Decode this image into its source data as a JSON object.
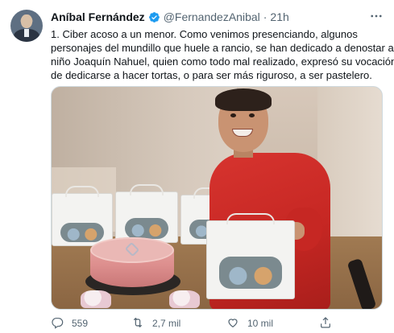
{
  "author": {
    "display_name": "Aníbal Fernández",
    "handle": "@FernandezAnibal",
    "separator": "·",
    "time": "21h"
  },
  "tweet": {
    "lines": [
      "1. Ciber acoso a un menor. Como venimos presenciando, algunos",
      "personajes del mundillo que huele a rancio, se han dedicado a denostar al",
      "niño Joaquín Nahuel, quien como todo mal realizado, expresó su vocación",
      "de dedicarse a hacer tortas, o para ser más riguroso, a ser pastelero."
    ]
  },
  "actions": {
    "reply_count": "559",
    "retweet_count": "2,7 mil",
    "like_count": "10 mil",
    "share_label": ""
  },
  "icons": {
    "verified": "verified-badge-icon",
    "more": "more-options-icon",
    "reply": "reply-icon",
    "retweet": "retweet-icon",
    "like": "heart-icon",
    "share": "share-icon"
  },
  "colors": {
    "verified": "#1d9bf0",
    "secondary_text": "#536471",
    "primary_text": "#0f1419",
    "border": "#cfd9de"
  }
}
